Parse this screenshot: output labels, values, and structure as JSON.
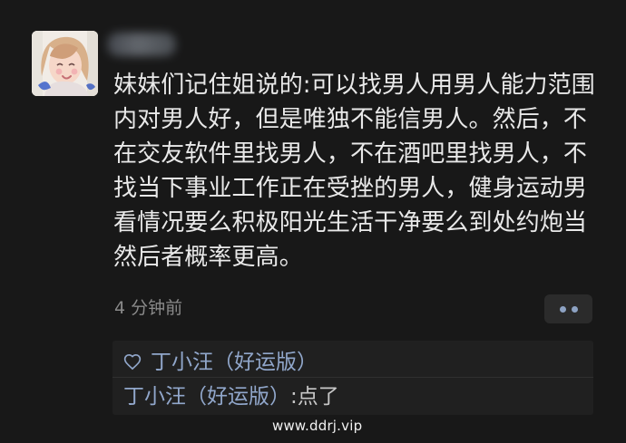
{
  "post": {
    "text": "妹妹们记住姐说的:可以找男人用男人能力范围内对男人好，但是唯独不能信男人。然后，不在交友软件里找男人，不在酒吧里找男人，不找当下事业工作正在受挫的男人，健身运动男看情况要么积极阳光生活干净要么到处约炮当然后者概率更高。",
    "time": "4 分钟前"
  },
  "interaction": {
    "likes": {
      "name": "丁小汪（好运版）"
    },
    "comment": {
      "author": "丁小汪（好运版）",
      "separator": ":",
      "text": "点了"
    }
  },
  "watermark": "www.ddrj.vip",
  "icons": {
    "avatar": "avatar-image",
    "like": "heart-icon",
    "more": "more-options-icon"
  },
  "colors": {
    "background": "#181818",
    "primary_text": "#e9e9e9",
    "secondary_text": "#8a8a8a",
    "link": "#91a7cb",
    "panel": "#202020"
  }
}
